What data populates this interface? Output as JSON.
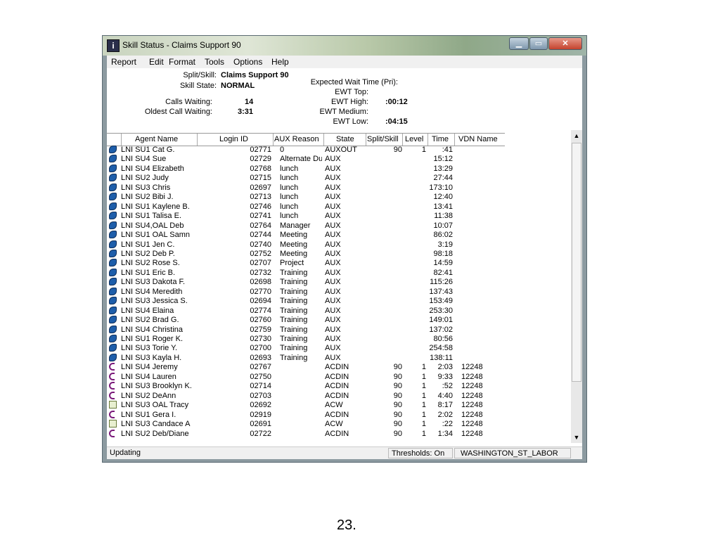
{
  "window": {
    "title": "Skill Status - Claims Support 90",
    "app_icon_glyph": "i"
  },
  "menu": [
    "Report",
    "Edit",
    "Format",
    "Tools",
    "Options",
    "Help"
  ],
  "info": {
    "split_skill_label": "Split/Skill:",
    "split_skill_value": "Claims Support 90",
    "skill_state_label": "Skill State:",
    "skill_state_value": "NORMAL",
    "calls_waiting_label": "Calls Waiting:",
    "calls_waiting_value": "14",
    "oldest_call_label": "Oldest Call Waiting:",
    "oldest_call_value": "3:31",
    "ewt_title": "Expected Wait Time (Pri):",
    "ewt_top_label": "EWT Top:",
    "ewt_top_value": "",
    "ewt_high_label": "EWT High:",
    "ewt_high_value": ":00:12",
    "ewt_medium_label": "EWT Medium:",
    "ewt_medium_value": "",
    "ewt_low_label": "EWT Low:",
    "ewt_low_value": ":04:15"
  },
  "columns": [
    "Agent Name",
    "Login ID",
    "AUX Reason",
    "State",
    "Split/Skill",
    "Level",
    "Time",
    "VDN Name"
  ],
  "rows": [
    {
      "icon": "aux",
      "name": "LNI SU1 Cat G.",
      "id": "02771",
      "reason": "0",
      "state": "AUXOUT",
      "skill": "90",
      "level": "1",
      "time": ":41",
      "vdn": ""
    },
    {
      "icon": "aux",
      "name": "LNI SU4 Sue",
      "id": "02729",
      "reason": "Alternate Du",
      "state": "AUX",
      "skill": "",
      "level": "",
      "time": "15:12",
      "vdn": ""
    },
    {
      "icon": "aux",
      "name": "LNI SU4 Elizabeth",
      "id": "02768",
      "reason": "lunch",
      "state": "AUX",
      "skill": "",
      "level": "",
      "time": "13:29",
      "vdn": ""
    },
    {
      "icon": "aux",
      "name": "LNI SU2 Judy",
      "id": "02715",
      "reason": "lunch",
      "state": "AUX",
      "skill": "",
      "level": "",
      "time": "27:44",
      "vdn": ""
    },
    {
      "icon": "aux",
      "name": "LNI SU3 Chris",
      "id": "02697",
      "reason": "lunch",
      "state": "AUX",
      "skill": "",
      "level": "",
      "time": "173:10",
      "vdn": ""
    },
    {
      "icon": "aux",
      "name": "LNI SU2 Bibi J.",
      "id": "02713",
      "reason": "lunch",
      "state": "AUX",
      "skill": "",
      "level": "",
      "time": "12:40",
      "vdn": ""
    },
    {
      "icon": "aux",
      "name": "LNI SU1 Kaylene B.",
      "id": "02746",
      "reason": "lunch",
      "state": "AUX",
      "skill": "",
      "level": "",
      "time": "13:41",
      "vdn": ""
    },
    {
      "icon": "aux",
      "name": "LNI SU1 Talisa E.",
      "id": "02741",
      "reason": "lunch",
      "state": "AUX",
      "skill": "",
      "level": "",
      "time": "11:38",
      "vdn": ""
    },
    {
      "icon": "aux",
      "name": "LNI SU4,OAL Deb",
      "id": "02764",
      "reason": "Manager",
      "state": "AUX",
      "skill": "",
      "level": "",
      "time": "10:07",
      "vdn": ""
    },
    {
      "icon": "aux",
      "name": "LNI SU1 OAL Samn",
      "id": "02744",
      "reason": "Meeting",
      "state": "AUX",
      "skill": "",
      "level": "",
      "time": "86:02",
      "vdn": ""
    },
    {
      "icon": "aux",
      "name": "LNI SU1 Jen C.",
      "id": "02740",
      "reason": "Meeting",
      "state": "AUX",
      "skill": "",
      "level": "",
      "time": "3:19",
      "vdn": ""
    },
    {
      "icon": "aux",
      "name": "LNI SU2 Deb P.",
      "id": "02752",
      "reason": "Meeting",
      "state": "AUX",
      "skill": "",
      "level": "",
      "time": "98:18",
      "vdn": ""
    },
    {
      "icon": "aux",
      "name": "LNI SU2 Rose S.",
      "id": "02707",
      "reason": "Project",
      "state": "AUX",
      "skill": "",
      "level": "",
      "time": "14:59",
      "vdn": ""
    },
    {
      "icon": "aux",
      "name": "LNI SU1 Eric B.",
      "id": "02732",
      "reason": "Training",
      "state": "AUX",
      "skill": "",
      "level": "",
      "time": "82:41",
      "vdn": ""
    },
    {
      "icon": "aux",
      "name": "LNI SU3 Dakota F.",
      "id": "02698",
      "reason": "Training",
      "state": "AUX",
      "skill": "",
      "level": "",
      "time": "115:26",
      "vdn": ""
    },
    {
      "icon": "aux",
      "name": "LNI SU4 Meredith",
      "id": "02770",
      "reason": "Training",
      "state": "AUX",
      "skill": "",
      "level": "",
      "time": "137:43",
      "vdn": ""
    },
    {
      "icon": "aux",
      "name": "LNI SU3 Jessica S.",
      "id": "02694",
      "reason": "Training",
      "state": "AUX",
      "skill": "",
      "level": "",
      "time": "153:49",
      "vdn": ""
    },
    {
      "icon": "aux",
      "name": "LNI SU4 Elaina",
      "id": "02774",
      "reason": "Training",
      "state": "AUX",
      "skill": "",
      "level": "",
      "time": "253:30",
      "vdn": ""
    },
    {
      "icon": "aux",
      "name": "LNI SU2 Brad G.",
      "id": "02760",
      "reason": "Training",
      "state": "AUX",
      "skill": "",
      "level": "",
      "time": "149:01",
      "vdn": ""
    },
    {
      "icon": "aux",
      "name": "LNI SU4 Christina",
      "id": "02759",
      "reason": "Training",
      "state": "AUX",
      "skill": "",
      "level": "",
      "time": "137:02",
      "vdn": ""
    },
    {
      "icon": "aux",
      "name": "LNI SU1 Roger K.",
      "id": "02730",
      "reason": "Training",
      "state": "AUX",
      "skill": "",
      "level": "",
      "time": "80:56",
      "vdn": ""
    },
    {
      "icon": "aux",
      "name": "LNI SU3 Torie Y.",
      "id": "02700",
      "reason": "Training",
      "state": "AUX",
      "skill": "",
      "level": "",
      "time": "254:58",
      "vdn": ""
    },
    {
      "icon": "aux",
      "name": "LNI SU3 Kayla H.",
      "id": "02693",
      "reason": "Training",
      "state": "AUX",
      "skill": "",
      "level": "",
      "time": "138:11",
      "vdn": ""
    },
    {
      "icon": "acd",
      "name": "LNI SU4 Jeremy",
      "id": "02767",
      "reason": "",
      "state": "ACDIN",
      "skill": "90",
      "level": "1",
      "time": "2:03",
      "vdn": "12248"
    },
    {
      "icon": "acd",
      "name": "LNI SU4 Lauren",
      "id": "02750",
      "reason": "",
      "state": "ACDIN",
      "skill": "90",
      "level": "1",
      "time": "9:33",
      "vdn": "12248"
    },
    {
      "icon": "acd",
      "name": "LNI SU3 Brooklyn K.",
      "id": "02714",
      "reason": "",
      "state": "ACDIN",
      "skill": "90",
      "level": "1",
      "time": ":52",
      "vdn": "12248"
    },
    {
      "icon": "acd",
      "name": "LNI SU2 DeAnn",
      "id": "02703",
      "reason": "",
      "state": "ACDIN",
      "skill": "90",
      "level": "1",
      "time": "4:40",
      "vdn": "12248"
    },
    {
      "icon": "acw",
      "name": "LNI SU3 OAL Tracy",
      "id": "02692",
      "reason": "",
      "state": "ACW",
      "skill": "90",
      "level": "1",
      "time": "8:17",
      "vdn": "12248"
    },
    {
      "icon": "acd",
      "name": "LNI SU1 Gera I.",
      "id": "02919",
      "reason": "",
      "state": "ACDIN",
      "skill": "90",
      "level": "1",
      "time": "2:02",
      "vdn": "12248"
    },
    {
      "icon": "acw",
      "name": "LNI SU3 Candace A",
      "id": "02691",
      "reason": "",
      "state": "ACW",
      "skill": "90",
      "level": "1",
      "time": ":22",
      "vdn": "12248"
    },
    {
      "icon": "acd",
      "name": "LNI SU2 Deb/Diane",
      "id": "02722",
      "reason": "",
      "state": "ACDIN",
      "skill": "90",
      "level": "1",
      "time": "1:34",
      "vdn": "12248"
    }
  ],
  "status": {
    "left": "Updating",
    "thresholds": "Thresholds: On",
    "server": "WASHINGTON_ST_LABOR"
  },
  "page_number": "23."
}
